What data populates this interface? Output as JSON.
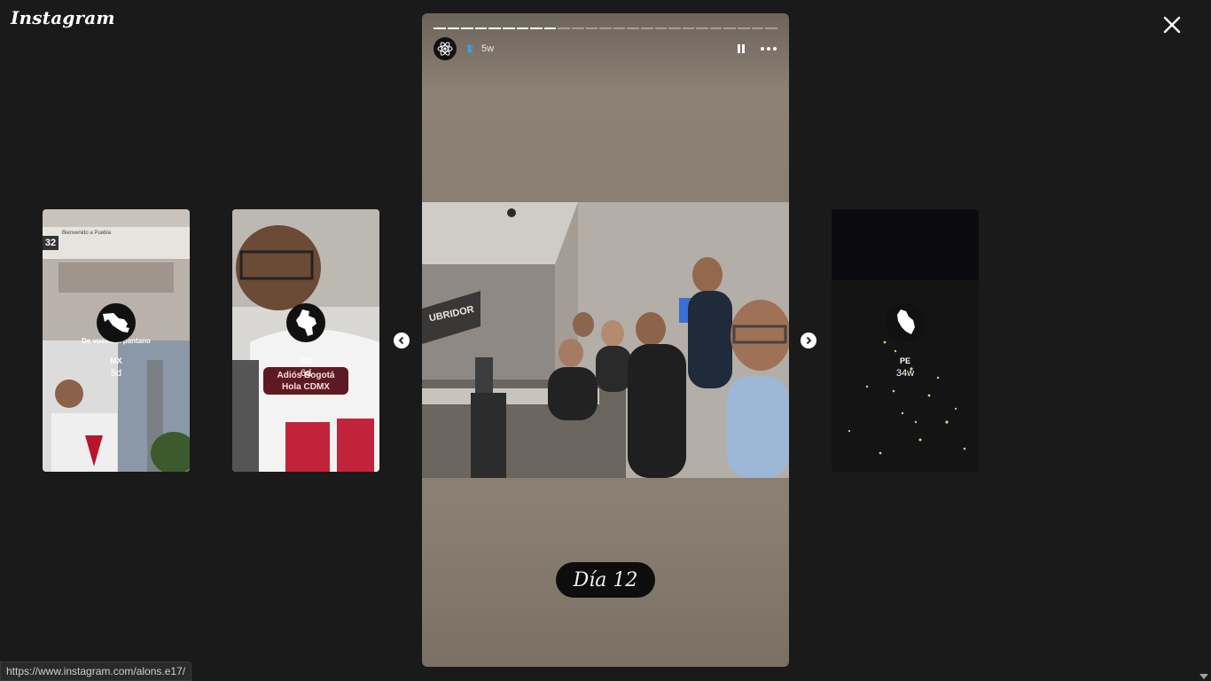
{
  "app": {
    "logo_text": "Instagram"
  },
  "viewer": {
    "close_label": "×",
    "prev_label": "‹",
    "next_label": "›"
  },
  "side_stories": [
    {
      "country": "MX",
      "ago": "5d",
      "overlay": "De vuelta al pantano",
      "sign": "Bienvenido a Puebla",
      "badge": "32"
    },
    {
      "country": "CO",
      "ago": "6d",
      "overlay_line1": "Adiós Bogotá",
      "overlay_line2": "Hola CDMX"
    },
    {
      "country": "PE",
      "ago": "34w"
    }
  ],
  "story": {
    "time_ago": "5w",
    "segments_total": 25,
    "segments_done": 9,
    "sticker_text": "Día 12",
    "photo_wall_text": "UBRIDOR",
    "pause_icon": "pause-icon",
    "more_icon": "more-horizontal-icon"
  },
  "status_bar": {
    "url": "https://www.instagram.com/alons.e17/"
  }
}
